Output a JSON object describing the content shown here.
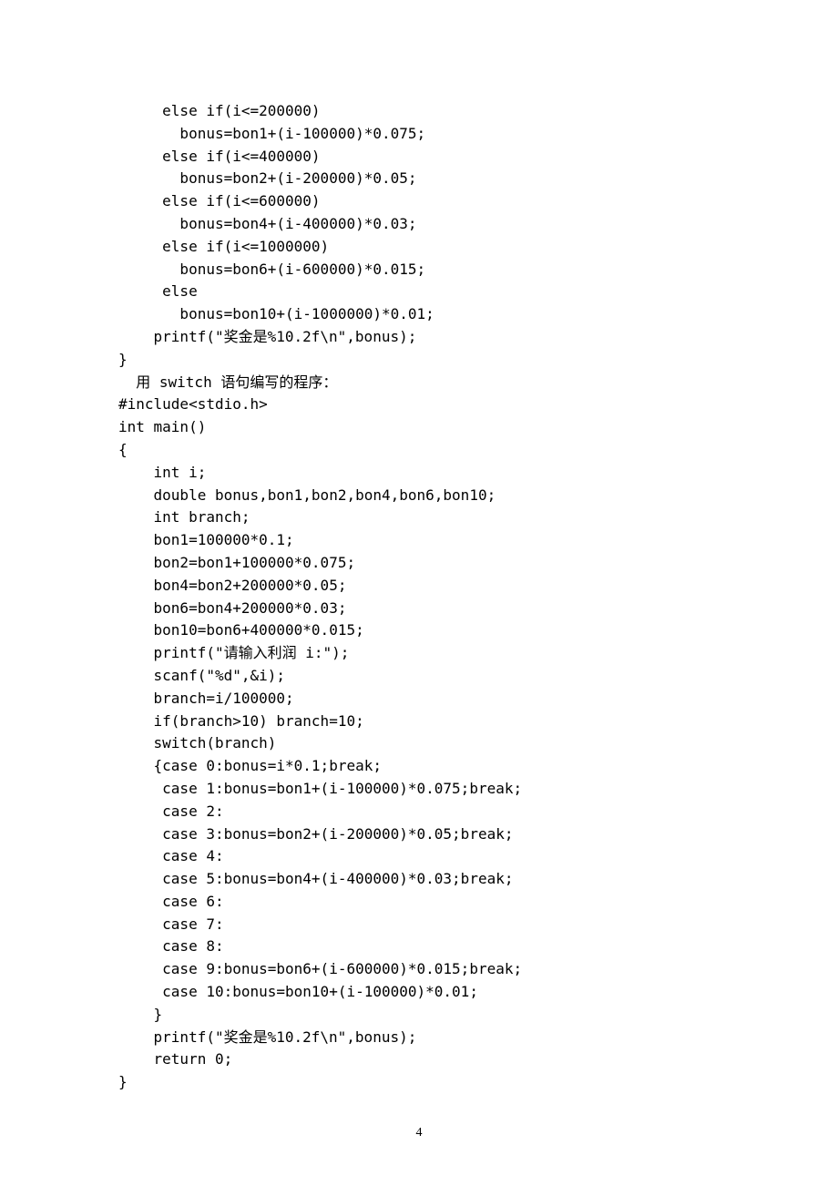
{
  "lines": [
    "     else if(i<=200000)",
    "       bonus=bon1+(i-100000)*0.075;",
    "     else if(i<=400000)",
    "       bonus=bon2+(i-200000)*0.05;",
    "     else if(i<=600000)",
    "       bonus=bon4+(i-400000)*0.03;",
    "     else if(i<=1000000)",
    "       bonus=bon6+(i-600000)*0.015;",
    "     else",
    "       bonus=bon10+(i-1000000)*0.01;",
    "    printf(\"奖金是%10.2f\\n\",bonus);",
    "}",
    "  用 switch 语句编写的程序：",
    "#include<stdio.h>",
    "int main()",
    "{",
    "    int i;",
    "    double bonus,bon1,bon2,bon4,bon6,bon10;",
    "    int branch;",
    "    bon1=100000*0.1;",
    "    bon2=bon1+100000*0.075;",
    "    bon4=bon2+200000*0.05;",
    "    bon6=bon4+200000*0.03;",
    "    bon10=bon6+400000*0.015;",
    "    printf(\"请输入利润 i:\");",
    "    scanf(\"%d\",&i);",
    "    branch=i/100000;",
    "    if(branch>10) branch=10;",
    "    switch(branch)",
    "    {case 0:bonus=i*0.1;break;",
    "     case 1:bonus=bon1+(i-100000)*0.075;break;",
    "     case 2:",
    "     case 3:bonus=bon2+(i-200000)*0.05;break;",
    "     case 4:",
    "     case 5:bonus=bon4+(i-400000)*0.03;break;",
    "     case 6:",
    "     case 7:",
    "     case 8:",
    "     case 9:bonus=bon6+(i-600000)*0.015;break;",
    "     case 10:bonus=bon10+(i-100000)*0.01;",
    "    }",
    "    printf(\"奖金是%10.2f\\n\",bonus);",
    "    return 0;",
    "}"
  ],
  "page_number": "4"
}
